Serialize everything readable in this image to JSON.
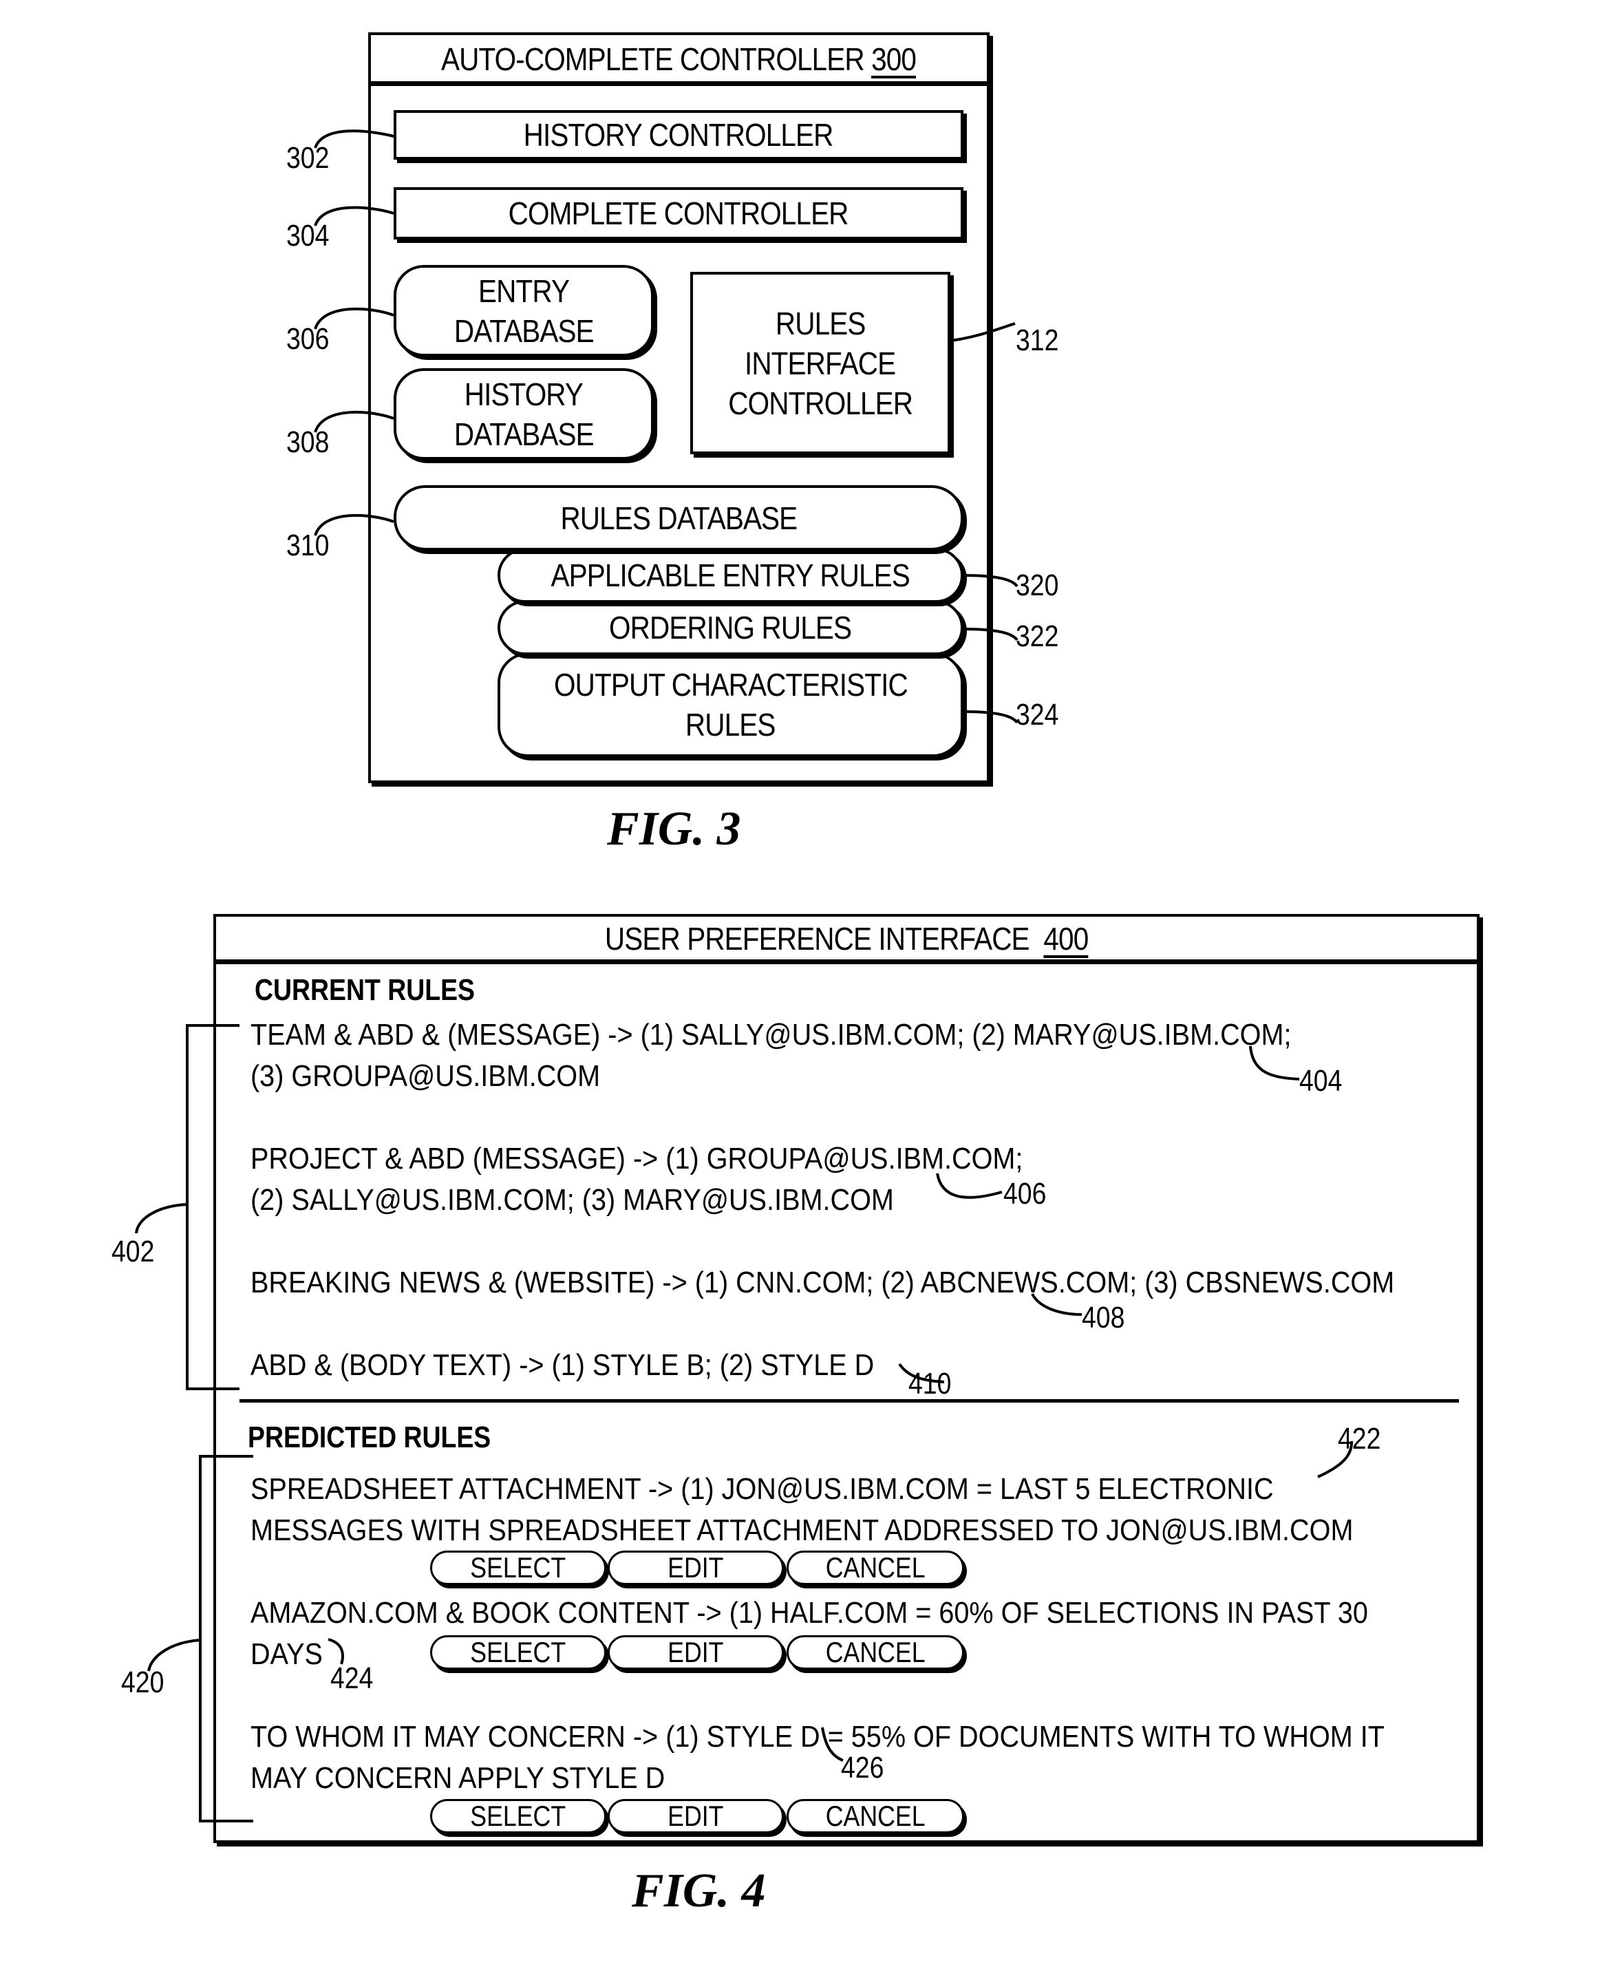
{
  "fig3": {
    "caption": "FIG. 3",
    "container": {
      "title": "AUTO-COMPLETE CONTROLLER",
      "ref": "300"
    },
    "components": [
      {
        "key": "history_controller",
        "label": "HISTORY CONTROLLER",
        "ref": "302"
      },
      {
        "key": "complete_controller",
        "label": "COMPLETE CONTROLLER",
        "ref": "304"
      },
      {
        "key": "entry_database",
        "label_lines": [
          "ENTRY",
          "DATABASE"
        ],
        "ref": "306"
      },
      {
        "key": "history_database",
        "label_lines": [
          "HISTORY",
          "DATABASE"
        ],
        "ref": "308"
      },
      {
        "key": "rules_database",
        "label": "RULES DATABASE",
        "ref": "310"
      },
      {
        "key": "rules_interface_controller",
        "label_lines": [
          "RULES",
          "INTERFACE",
          "CONTROLLER"
        ],
        "ref": "312"
      },
      {
        "key": "applicable_entry_rules",
        "label": "APPLICABLE ENTRY RULES",
        "ref": "320"
      },
      {
        "key": "ordering_rules",
        "label": "ORDERING RULES",
        "ref": "322"
      },
      {
        "key": "output_characteristic_rules",
        "label_lines": [
          "OUTPUT CHARACTERISTIC",
          "RULES"
        ],
        "ref": "324"
      }
    ]
  },
  "fig4": {
    "caption": "FIG. 4",
    "window": {
      "title": "USER PREFERENCE INTERFACE",
      "ref": "400"
    },
    "current_rules": {
      "title": "CURRENT RULES",
      "bracket_ref": "402",
      "rules": [
        {
          "lines": [
            "TEAM & ABD & (MESSAGE) -> (1) SALLY@US.IBM.COM; (2) MARY@US.IBM.COM;",
            "(3) GROUPA@US.IBM.COM"
          ],
          "ref": "404"
        },
        {
          "lines": [
            "PROJECT & ABD (MESSAGE) -> (1) GROUPA@US.IBM.COM;",
            "(2) SALLY@US.IBM.COM; (3) MARY@US.IBM.COM"
          ],
          "ref": "406"
        },
        {
          "lines": [
            "BREAKING NEWS & (WEBSITE) -> (1) CNN.COM; (2) ABCNEWS.COM; (3) CBSNEWS.COM"
          ],
          "ref": "408"
        },
        {
          "lines": [
            "ABD & (BODY TEXT) -> (1) STYLE B; (2) STYLE D"
          ],
          "ref": "410"
        }
      ]
    },
    "predicted_rules": {
      "title": "PREDICTED RULES",
      "bracket_ref": "420",
      "rules": [
        {
          "lines": [
            "SPREADSHEET ATTACHMENT -> (1) JON@US.IBM.COM = LAST 5 ELECTRONIC",
            "MESSAGES WITH SPREADSHEET ATTACHMENT ADDRESSED TO JON@US.IBM.COM"
          ],
          "ref": "422"
        },
        {
          "lines": [
            "AMAZON.COM & BOOK CONTENT -> (1) HALF.COM = 60% OF SELECTIONS IN PAST 30",
            "DAYS"
          ],
          "ref": "424"
        },
        {
          "lines": [
            "TO WHOM IT MAY CONCERN -> (1) STYLE D = 55% OF DOCUMENTS WITH TO WHOM IT",
            "MAY CONCERN APPLY STYLE D"
          ],
          "ref": "426"
        }
      ],
      "actions": {
        "select": "SELECT",
        "edit": "EDIT",
        "cancel": "CANCEL"
      }
    }
  }
}
